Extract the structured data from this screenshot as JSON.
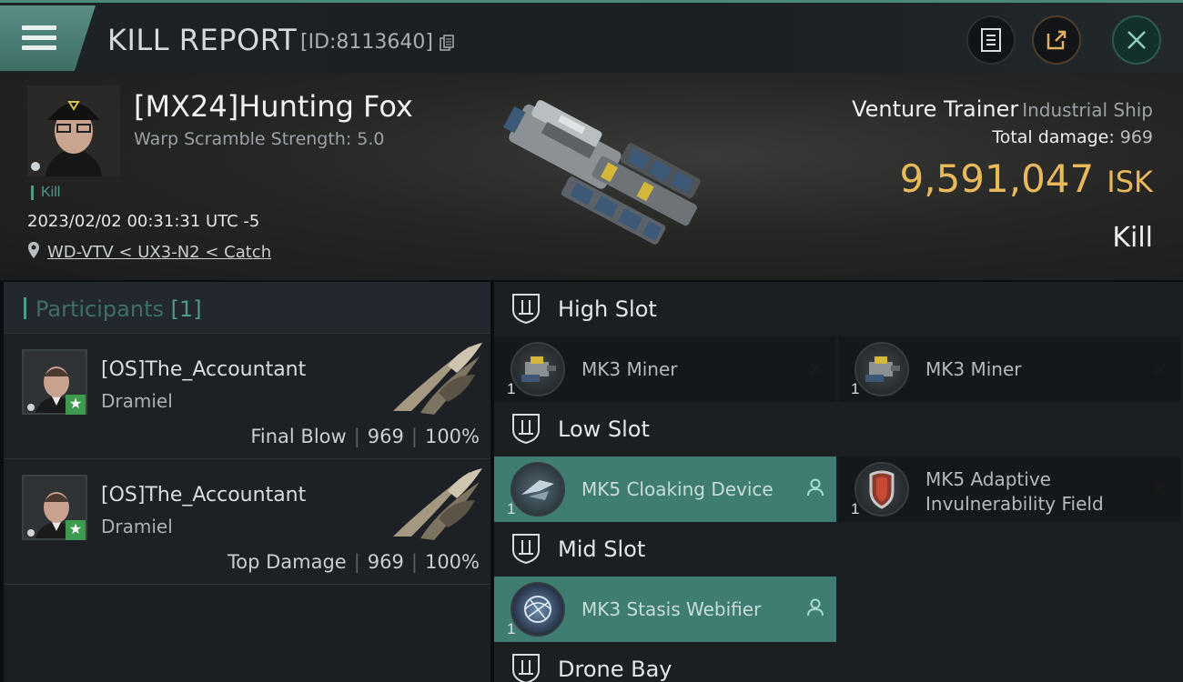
{
  "header": {
    "title": "KILL REPORT",
    "report_id": "[ID:8113640]"
  },
  "victim": {
    "name": "[MX24]Hunting Fox",
    "scram": "Warp Scramble Strength: 5.0",
    "kill_tag": "Kill",
    "datetime": "2023/02/02 00:31:31 UTC -5",
    "location": "WD-VTV < UX3-N2 < Catch"
  },
  "ship": {
    "name": "Venture Trainer",
    "class": "Industrial Ship",
    "damage_label": "Total damage:",
    "damage_value": "969",
    "isk_value": "9,591,047",
    "isk_unit": "ISK",
    "result": "Kill"
  },
  "participants": {
    "title": "Participants",
    "count": "[1]",
    "rows": [
      {
        "name": "[OS]The_Accountant",
        "ship": "Dramiel",
        "role": "Final Blow",
        "damage": "969",
        "percent": "100%"
      },
      {
        "name": "[OS]The_Accountant",
        "ship": "Dramiel",
        "role": "Top Damage",
        "damage": "969",
        "percent": "100%"
      }
    ]
  },
  "slots": {
    "high": {
      "label": "High Slot",
      "modules": [
        {
          "name": "MK3 Miner",
          "qty": "1"
        },
        {
          "name": "MK3 Miner",
          "qty": "1"
        }
      ]
    },
    "low": {
      "label": "Low Slot",
      "modules": [
        {
          "name": "MK5 Cloaking Device",
          "qty": "1"
        },
        {
          "name": "MK5 Adaptive Invulnerability Field",
          "line1": "MK5 Adaptive",
          "line2": "Invulnerability Field",
          "qty": "1"
        }
      ]
    },
    "mid": {
      "label": "Mid Slot",
      "modules": [
        {
          "name": "MK3 Stasis Webifier",
          "qty": "1"
        }
      ]
    },
    "drone": {
      "label": "Drone Bay"
    }
  },
  "colors": {
    "accent": "#4f9a8c",
    "isk": "#e7b95a",
    "active_module": "#3f7d73"
  }
}
